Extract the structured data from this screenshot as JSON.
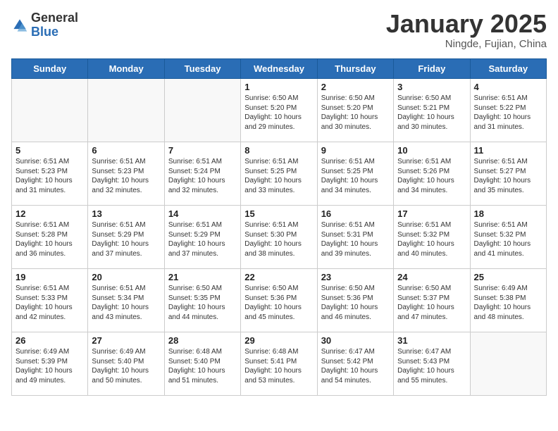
{
  "logo": {
    "general": "General",
    "blue": "Blue"
  },
  "title": "January 2025",
  "subtitle": "Ningde, Fujian, China",
  "days_of_week": [
    "Sunday",
    "Monday",
    "Tuesday",
    "Wednesday",
    "Thursday",
    "Friday",
    "Saturday"
  ],
  "weeks": [
    [
      {
        "day": "",
        "info": ""
      },
      {
        "day": "",
        "info": ""
      },
      {
        "day": "",
        "info": ""
      },
      {
        "day": "1",
        "info": "Sunrise: 6:50 AM\nSunset: 5:20 PM\nDaylight: 10 hours\nand 29 minutes."
      },
      {
        "day": "2",
        "info": "Sunrise: 6:50 AM\nSunset: 5:20 PM\nDaylight: 10 hours\nand 30 minutes."
      },
      {
        "day": "3",
        "info": "Sunrise: 6:50 AM\nSunset: 5:21 PM\nDaylight: 10 hours\nand 30 minutes."
      },
      {
        "day": "4",
        "info": "Sunrise: 6:51 AM\nSunset: 5:22 PM\nDaylight: 10 hours\nand 31 minutes."
      }
    ],
    [
      {
        "day": "5",
        "info": "Sunrise: 6:51 AM\nSunset: 5:23 PM\nDaylight: 10 hours\nand 31 minutes."
      },
      {
        "day": "6",
        "info": "Sunrise: 6:51 AM\nSunset: 5:23 PM\nDaylight: 10 hours\nand 32 minutes."
      },
      {
        "day": "7",
        "info": "Sunrise: 6:51 AM\nSunset: 5:24 PM\nDaylight: 10 hours\nand 32 minutes."
      },
      {
        "day": "8",
        "info": "Sunrise: 6:51 AM\nSunset: 5:25 PM\nDaylight: 10 hours\nand 33 minutes."
      },
      {
        "day": "9",
        "info": "Sunrise: 6:51 AM\nSunset: 5:25 PM\nDaylight: 10 hours\nand 34 minutes."
      },
      {
        "day": "10",
        "info": "Sunrise: 6:51 AM\nSunset: 5:26 PM\nDaylight: 10 hours\nand 34 minutes."
      },
      {
        "day": "11",
        "info": "Sunrise: 6:51 AM\nSunset: 5:27 PM\nDaylight: 10 hours\nand 35 minutes."
      }
    ],
    [
      {
        "day": "12",
        "info": "Sunrise: 6:51 AM\nSunset: 5:28 PM\nDaylight: 10 hours\nand 36 minutes."
      },
      {
        "day": "13",
        "info": "Sunrise: 6:51 AM\nSunset: 5:29 PM\nDaylight: 10 hours\nand 37 minutes."
      },
      {
        "day": "14",
        "info": "Sunrise: 6:51 AM\nSunset: 5:29 PM\nDaylight: 10 hours\nand 37 minutes."
      },
      {
        "day": "15",
        "info": "Sunrise: 6:51 AM\nSunset: 5:30 PM\nDaylight: 10 hours\nand 38 minutes."
      },
      {
        "day": "16",
        "info": "Sunrise: 6:51 AM\nSunset: 5:31 PM\nDaylight: 10 hours\nand 39 minutes."
      },
      {
        "day": "17",
        "info": "Sunrise: 6:51 AM\nSunset: 5:32 PM\nDaylight: 10 hours\nand 40 minutes."
      },
      {
        "day": "18",
        "info": "Sunrise: 6:51 AM\nSunset: 5:32 PM\nDaylight: 10 hours\nand 41 minutes."
      }
    ],
    [
      {
        "day": "19",
        "info": "Sunrise: 6:51 AM\nSunset: 5:33 PM\nDaylight: 10 hours\nand 42 minutes."
      },
      {
        "day": "20",
        "info": "Sunrise: 6:51 AM\nSunset: 5:34 PM\nDaylight: 10 hours\nand 43 minutes."
      },
      {
        "day": "21",
        "info": "Sunrise: 6:50 AM\nSunset: 5:35 PM\nDaylight: 10 hours\nand 44 minutes."
      },
      {
        "day": "22",
        "info": "Sunrise: 6:50 AM\nSunset: 5:36 PM\nDaylight: 10 hours\nand 45 minutes."
      },
      {
        "day": "23",
        "info": "Sunrise: 6:50 AM\nSunset: 5:36 PM\nDaylight: 10 hours\nand 46 minutes."
      },
      {
        "day": "24",
        "info": "Sunrise: 6:50 AM\nSunset: 5:37 PM\nDaylight: 10 hours\nand 47 minutes."
      },
      {
        "day": "25",
        "info": "Sunrise: 6:49 AM\nSunset: 5:38 PM\nDaylight: 10 hours\nand 48 minutes."
      }
    ],
    [
      {
        "day": "26",
        "info": "Sunrise: 6:49 AM\nSunset: 5:39 PM\nDaylight: 10 hours\nand 49 minutes."
      },
      {
        "day": "27",
        "info": "Sunrise: 6:49 AM\nSunset: 5:40 PM\nDaylight: 10 hours\nand 50 minutes."
      },
      {
        "day": "28",
        "info": "Sunrise: 6:48 AM\nSunset: 5:40 PM\nDaylight: 10 hours\nand 51 minutes."
      },
      {
        "day": "29",
        "info": "Sunrise: 6:48 AM\nSunset: 5:41 PM\nDaylight: 10 hours\nand 53 minutes."
      },
      {
        "day": "30",
        "info": "Sunrise: 6:47 AM\nSunset: 5:42 PM\nDaylight: 10 hours\nand 54 minutes."
      },
      {
        "day": "31",
        "info": "Sunrise: 6:47 AM\nSunset: 5:43 PM\nDaylight: 10 hours\nand 55 minutes."
      },
      {
        "day": "",
        "info": ""
      }
    ]
  ]
}
